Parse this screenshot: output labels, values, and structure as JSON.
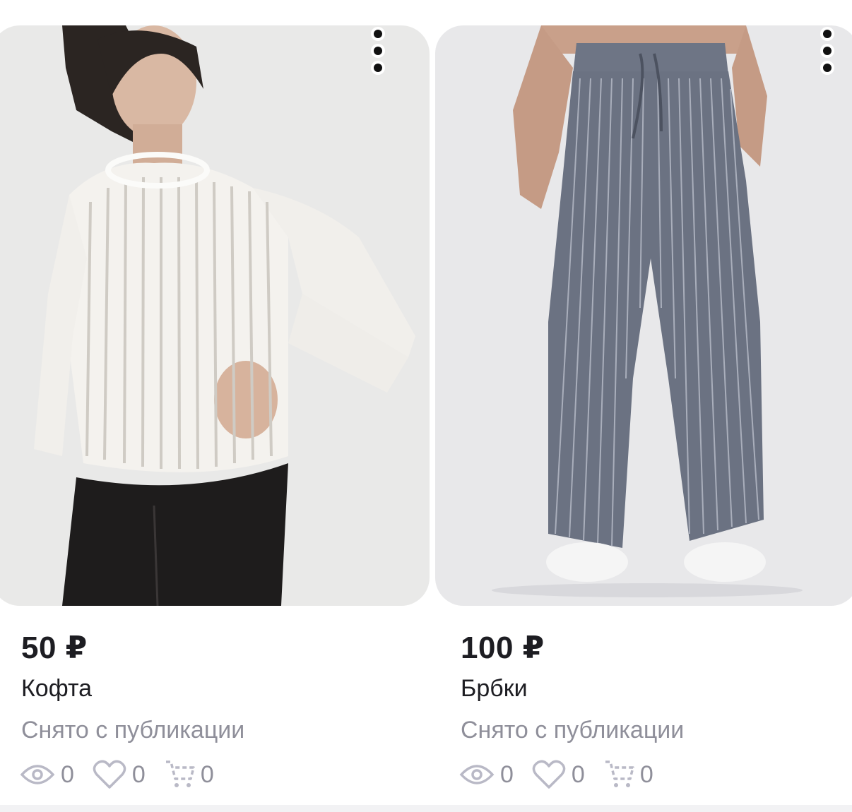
{
  "currency_note": "",
  "listings": [
    {
      "price": "50 ₽",
      "title": "Кофта",
      "status": "Снято с публикации",
      "views": "0",
      "likes": "0",
      "in_cart": "0"
    },
    {
      "price": "100 ₽",
      "title": "Брбки",
      "status": "Снято с публикации",
      "views": "0",
      "likes": "0",
      "in_cart": "0"
    }
  ],
  "colors": {
    "price_text": "#1d1d22",
    "muted_text": "#8f8f9a",
    "icon_stroke": "#b9b9c6"
  },
  "icons": [
    "more-vertical-icon",
    "eye-icon",
    "heart-icon",
    "cart-icon"
  ]
}
